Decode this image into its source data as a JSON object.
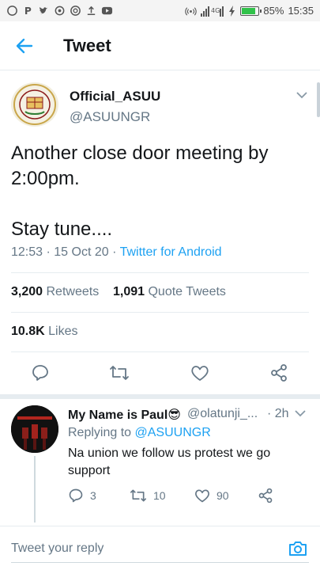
{
  "status_bar": {
    "battery": "85%",
    "battery_level": 0.85,
    "time": "15:35",
    "signal": "4G"
  },
  "header": {
    "title": "Tweet"
  },
  "tweet": {
    "author_name": "Official_ASUU",
    "author_handle": "@ASUUNGR",
    "text_line1": "Another close door meeting by 2:00pm.",
    "text_line2": "Stay tune....",
    "time": "12:53",
    "date": "15 Oct 20",
    "separator": "·",
    "source": "Twitter for Android",
    "retweets_count": "3,200",
    "retweets_label": "Retweets",
    "quote_count": "1,091",
    "quote_label": "Quote Tweets",
    "likes_count": "10.8K",
    "likes_label": "Likes"
  },
  "reply": {
    "name": "My Name is Paul😎",
    "handle": "@olatunji_...",
    "time": "· 2h",
    "replying_prefix": "Replying to",
    "replying_to": "@ASUUNGR",
    "text": "Na union we follow us protest we go support",
    "reply_count": "3",
    "retweet_count": "10",
    "like_count": "90"
  },
  "compose": {
    "placeholder": "Tweet your reply"
  },
  "colors": {
    "accent": "#1da1f2",
    "muted": "#657786",
    "text": "#14171a"
  }
}
